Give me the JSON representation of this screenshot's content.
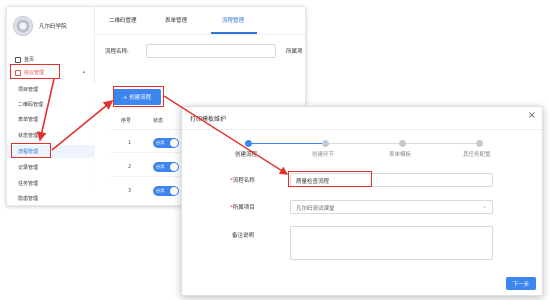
{
  "app": {
    "brand_name": "凡尔码学院",
    "top_tabs": [
      "二维码管理",
      "表单管理",
      "流程管理"
    ],
    "active_top_tab": "流程管理"
  },
  "sidebar": {
    "home": "首页",
    "group": "综合管理",
    "items": [
      "项目管理",
      "二维码管理",
      "表单管理",
      "状态管理",
      "流程管理",
      "记录管理",
      "任务管理",
      "隐患管理"
    ],
    "active_item": "流程管理"
  },
  "filter": {
    "name_label": "流程名称:",
    "project_label": "所属项"
  },
  "toolbar": {
    "create_label": "+ 创建流程"
  },
  "table": {
    "headers": [
      "序号",
      "状态"
    ],
    "rows": [
      {
        "index": "1",
        "status": "启用"
      },
      {
        "index": "2",
        "status": "启用"
      },
      {
        "index": "3",
        "status": "启用"
      }
    ]
  },
  "modal": {
    "title": "打印模板维护",
    "close_glyph": "×",
    "steps": [
      "创建流程",
      "创建环节",
      "表单模板",
      "其任务配置"
    ],
    "active_step": 0,
    "form": {
      "name_label": "流程名称",
      "name_value": "质量检查流程",
      "project_label": "所属项目",
      "project_value": "凡尔码测试课堂",
      "note_label": "备注说明",
      "required_mark": "*"
    },
    "next_label": "下一步"
  },
  "colors": {
    "accent": "#3d86f0",
    "highlight": "#e0322d",
    "group_text": "#e0554c"
  }
}
